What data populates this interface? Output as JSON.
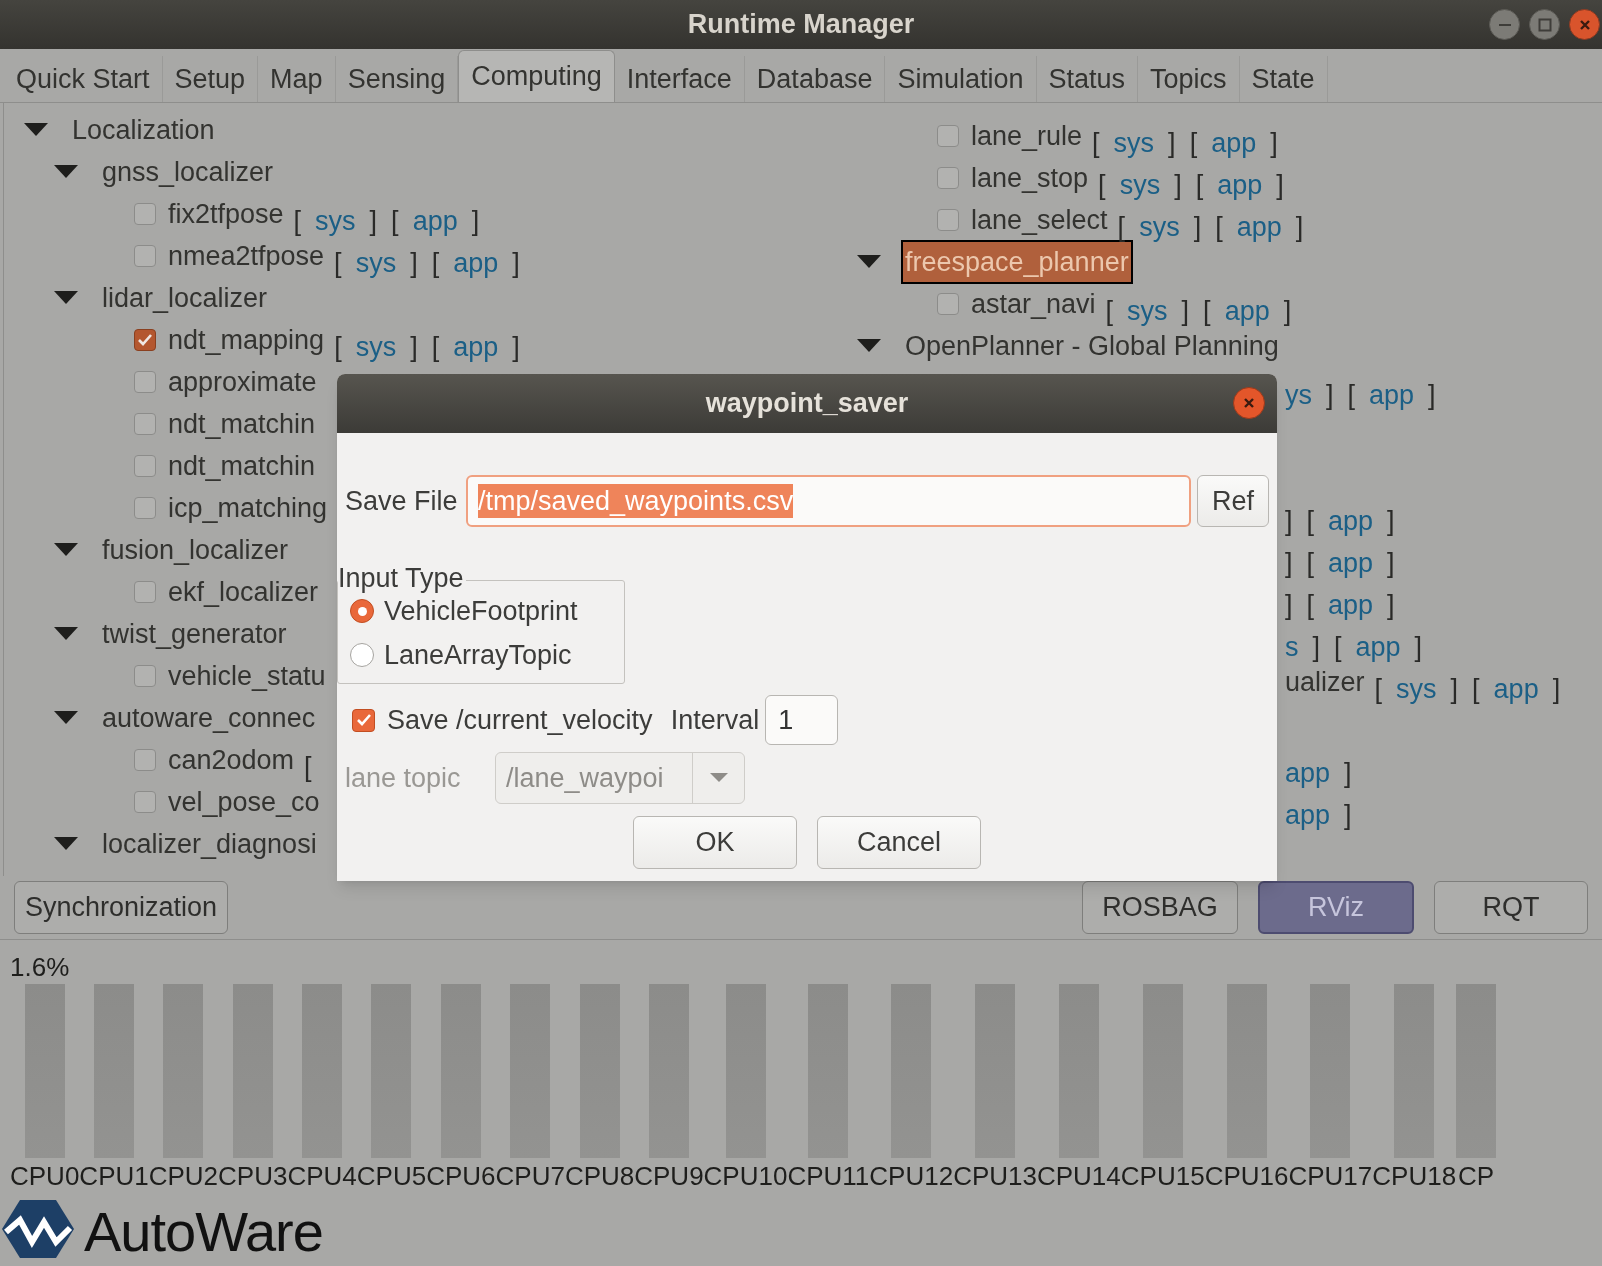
{
  "window": {
    "title": "Runtime Manager"
  },
  "tabs": [
    {
      "label": "Quick Start",
      "selected": false
    },
    {
      "label": "Setup",
      "selected": false
    },
    {
      "label": "Map",
      "selected": false
    },
    {
      "label": "Sensing",
      "selected": false
    },
    {
      "label": "Computing",
      "selected": true
    },
    {
      "label": "Interface",
      "selected": false
    },
    {
      "label": "Database",
      "selected": false
    },
    {
      "label": "Simulation",
      "selected": false
    },
    {
      "label": "Status",
      "selected": false
    },
    {
      "label": "Topics",
      "selected": false
    },
    {
      "label": "State",
      "selected": false
    }
  ],
  "tree_left": [
    {
      "label": "Localization",
      "expanded": true,
      "selected": false,
      "children": [
        {
          "label": "gnss_localizer",
          "expanded": true,
          "selected": false,
          "children": [
            {
              "label": "fix2tfpose",
              "checked": false,
              "selected": false,
              "tail": [
                {
                  "text": "[",
                  "kind": "bracket"
                },
                {
                  "text": "sys",
                  "kind": "link"
                },
                {
                  "text": "]",
                  "kind": "bracket"
                },
                {
                  "text": "[",
                  "kind": "bracket"
                },
                {
                  "text": "app",
                  "kind": "link"
                },
                {
                  "text": "]",
                  "kind": "bracket"
                }
              ]
            },
            {
              "label": "nmea2tfpose",
              "checked": false,
              "selected": false,
              "tail": [
                {
                  "text": "[",
                  "kind": "bracket"
                },
                {
                  "text": "sys",
                  "kind": "link"
                },
                {
                  "text": "]",
                  "kind": "bracket"
                },
                {
                  "text": "[",
                  "kind": "bracket"
                },
                {
                  "text": "app",
                  "kind": "link"
                },
                {
                  "text": "]",
                  "kind": "bracket"
                }
              ]
            }
          ]
        },
        {
          "label": "lidar_localizer",
          "expanded": true,
          "selected": false,
          "children": [
            {
              "label": "ndt_mapping",
              "checked": true,
              "selected": false,
              "tail": [
                {
                  "text": "[",
                  "kind": "bracket"
                },
                {
                  "text": "sys",
                  "kind": "link"
                },
                {
                  "text": "]",
                  "kind": "bracket"
                },
                {
                  "text": "[",
                  "kind": "bracket"
                },
                {
                  "text": "app",
                  "kind": "link"
                },
                {
                  "text": "]",
                  "kind": "bracket"
                }
              ]
            },
            {
              "label": "approximate",
              "checked": false,
              "selected": false
            },
            {
              "label": "ndt_matchin",
              "checked": false,
              "selected": false
            },
            {
              "label": "ndt_matchin",
              "checked": false,
              "selected": false
            },
            {
              "label": "icp_matching",
              "checked": false,
              "selected": false
            }
          ]
        },
        {
          "label": "fusion_localizer",
          "expanded": true,
          "selected": false,
          "children": [
            {
              "label": "ekf_localizer",
              "checked": false,
              "selected": false
            }
          ]
        },
        {
          "label": "twist_generator",
          "expanded": true,
          "selected": false,
          "children": [
            {
              "label": "vehicle_statu",
              "checked": false,
              "selected": false
            }
          ]
        },
        {
          "label": "autoware_connec",
          "expanded": true,
          "selected": false,
          "children": [
            {
              "label": "can2odom",
              "checked": false,
              "selected": false,
              "tail": [
                {
                  "text": "[",
                  "kind": "bracket"
                }
              ]
            },
            {
              "label": "vel_pose_co",
              "checked": false,
              "selected": false
            }
          ]
        },
        {
          "label": "localizer_diagnosi",
          "expanded": true,
          "selected": false
        }
      ]
    }
  ],
  "tree_right": [
    {
      "kind": "leaf",
      "label": "lane_rule",
      "checked": false,
      "selected": false,
      "tail": [
        {
          "text": "[",
          "kind": "bracket"
        },
        {
          "text": "sys",
          "kind": "link"
        },
        {
          "text": "]",
          "kind": "bracket"
        },
        {
          "text": "[",
          "kind": "bracket"
        },
        {
          "text": "app",
          "kind": "link"
        },
        {
          "text": "]",
          "kind": "bracket"
        }
      ]
    },
    {
      "kind": "leaf",
      "label": "lane_stop",
      "checked": false,
      "selected": false,
      "tail": [
        {
          "text": "[",
          "kind": "bracket"
        },
        {
          "text": "sys",
          "kind": "link"
        },
        {
          "text": "]",
          "kind": "bracket"
        },
        {
          "text": "[",
          "kind": "bracket"
        },
        {
          "text": "app",
          "kind": "link"
        },
        {
          "text": "]",
          "kind": "bracket"
        }
      ]
    },
    {
      "kind": "leaf",
      "label": "lane_select",
      "checked": false,
      "selected": false,
      "tail": [
        {
          "text": "[",
          "kind": "bracket"
        },
        {
          "text": "sys",
          "kind": "link"
        },
        {
          "text": "]",
          "kind": "bracket"
        },
        {
          "text": "[",
          "kind": "bracket"
        },
        {
          "text": "app",
          "kind": "link"
        },
        {
          "text": "]",
          "kind": "bracket"
        }
      ]
    },
    {
      "kind": "group",
      "label": "freespace_planner",
      "expanded": true,
      "selected": true
    },
    {
      "kind": "leaf",
      "label": "astar_navi",
      "checked": false,
      "selected": false,
      "tail": [
        {
          "text": "[",
          "kind": "bracket"
        },
        {
          "text": "sys",
          "kind": "link"
        },
        {
          "text": "]",
          "kind": "bracket"
        },
        {
          "text": "[",
          "kind": "bracket"
        },
        {
          "text": "app",
          "kind": "link"
        },
        {
          "text": "]",
          "kind": "bracket"
        }
      ]
    },
    {
      "kind": "group",
      "label": "OpenPlanner - Global Planning",
      "expanded": true,
      "selected": false
    },
    {
      "kind": "fragment",
      "tail": [
        {
          "text": "ys",
          "kind": "link"
        },
        {
          "text": "]",
          "kind": "bracket"
        },
        {
          "text": "[",
          "kind": "bracket"
        },
        {
          "text": "app",
          "kind": "link"
        },
        {
          "text": "]",
          "kind": "bracket"
        }
      ]
    },
    {
      "kind": "fragment",
      "tail": [
        {
          "text": "]",
          "kind": "bracket"
        },
        {
          "text": "[",
          "kind": "bracket"
        },
        {
          "text": "app",
          "kind": "link"
        },
        {
          "text": "]",
          "kind": "bracket"
        }
      ]
    },
    {
      "kind": "fragment",
      "tail": [
        {
          "text": "]",
          "kind": "bracket"
        },
        {
          "text": "[",
          "kind": "bracket"
        },
        {
          "text": "app",
          "kind": "link"
        },
        {
          "text": "]",
          "kind": "bracket"
        }
      ]
    },
    {
      "kind": "fragment",
      "tail": [
        {
          "text": "]",
          "kind": "bracket"
        },
        {
          "text": "[",
          "kind": "bracket"
        },
        {
          "text": "app",
          "kind": "link"
        },
        {
          "text": "]",
          "kind": "bracket"
        }
      ]
    },
    {
      "kind": "fragment",
      "tail": [
        {
          "text": "s",
          "kind": "link"
        },
        {
          "text": "]",
          "kind": "bracket"
        },
        {
          "text": "[",
          "kind": "bracket"
        },
        {
          "text": "app",
          "kind": "link"
        },
        {
          "text": "]",
          "kind": "bracket"
        }
      ]
    },
    {
      "kind": "fragment",
      "label": "ualizer",
      "tail": [
        {
          "text": "[",
          "kind": "bracket"
        },
        {
          "text": "sys",
          "kind": "link"
        },
        {
          "text": "]",
          "kind": "bracket"
        },
        {
          "text": "[",
          "kind": "bracket"
        },
        {
          "text": "app",
          "kind": "link"
        },
        {
          "text": "]",
          "kind": "bracket"
        }
      ]
    },
    {
      "kind": "fragment",
      "tail": [
        {
          "text": "app",
          "kind": "link"
        },
        {
          "text": "]",
          "kind": "bracket"
        }
      ]
    },
    {
      "kind": "fragment",
      "tail": [
        {
          "text": "app",
          "kind": "link"
        },
        {
          "text": "]",
          "kind": "bracket"
        }
      ]
    }
  ],
  "bottom_buttons": [
    {
      "label": "Synchronization",
      "selected": false
    },
    {
      "label": "ROSBAG",
      "selected": false
    },
    {
      "label": "RViz",
      "selected": true
    },
    {
      "label": "RQT",
      "selected": false
    }
  ],
  "cpu": {
    "usage": "1.6%",
    "labels": [
      "CPU0",
      "CPU1",
      "CPU2",
      "CPU3",
      "CPU4",
      "CPU5",
      "CPU6",
      "CPU7",
      "CPU8",
      "CPU9",
      "CPU10",
      "CPU11",
      "CPU12",
      "CPU13",
      "CPU14",
      "CPU15",
      "CPU16",
      "CPU17",
      "CPU18",
      "CP"
    ]
  },
  "logo": {
    "text": "AutoWare"
  },
  "dialog": {
    "title": "waypoint_saver",
    "save_file": {
      "label": "Save File",
      "value": "/tmp/saved_waypoints.csv",
      "selected": true,
      "button": "Ref"
    },
    "input_type": {
      "label": "Input Type",
      "options": [
        {
          "label": "VehicleFootprint",
          "selected": true
        },
        {
          "label": "LaneArrayTopic",
          "selected": false
        }
      ]
    },
    "save_velocity": {
      "label": "Save /current_velocity",
      "checked": true
    },
    "interval": {
      "label": "Interval",
      "value": "1"
    },
    "lane_topic": {
      "label": "lane topic",
      "value": "/lane_waypoi",
      "disabled": true
    },
    "buttons": [
      "OK",
      "Cancel"
    ]
  }
}
